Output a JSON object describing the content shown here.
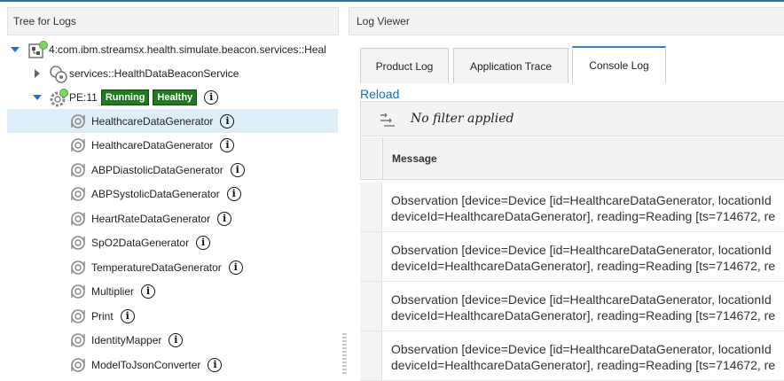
{
  "left": {
    "header": "Tree for Logs",
    "root_label": "4:com.ibm.streamsx.health.simulate.beacon.services::Heal",
    "service_label": "services::HealthDataBeaconService",
    "pe": {
      "label": "PE:11",
      "badge_running": "Running",
      "badge_healthy": "Healthy"
    },
    "operators": [
      "HealthcareDataGenerator",
      "HealthcareDataGenerator",
      "ABPDiastolicDataGenerator",
      "ABPSystolicDataGenerator",
      "HeartRateDataGenerator",
      "SpO2DataGenerator",
      "TemperatureDataGenerator",
      "Multiplier",
      "Print",
      "IdentityMapper",
      "ModelToJsonConverter"
    ],
    "info_glyph": "i"
  },
  "right": {
    "header": "Log Viewer",
    "tabs": [
      "Product Log",
      "Application Trace",
      "Console Log"
    ],
    "active_tab": "Console Log",
    "reload": "Reload",
    "filter_text": "No filter applied",
    "column_message": "Message",
    "rows": [
      {
        "line1": "Observation [device=Device [id=HealthcareDataGenerator, locationId",
        "line2": "deviceId=HealthcareDataGenerator], reading=Reading [ts=714672, re"
      },
      {
        "line1": "Observation [device=Device [id=HealthcareDataGenerator, locationId",
        "line2": "deviceId=HealthcareDataGenerator], reading=Reading [ts=714672, re"
      },
      {
        "line1": "Observation [device=Device [id=HealthcareDataGenerator, locationId",
        "line2": "deviceId=HealthcareDataGenerator], reading=Reading [ts=714672, re"
      },
      {
        "line1": "Observation [device=Device [id=HealthcareDataGenerator, locationId",
        "line2": "deviceId=HealthcareDataGenerator], reading=Reading [ts=714672, re"
      }
    ]
  },
  "colors": {
    "accent": "#1d74c6",
    "badge_green": "#217a1f",
    "selected_row": "#ddeef9",
    "status_dot": "#7ed36b"
  },
  "icons": [
    "expand-arrow-icon",
    "collapse-arrow-icon",
    "job-icon",
    "service-icon",
    "pe-gear-icon",
    "operator-icon",
    "info-icon",
    "filter-icon"
  ]
}
